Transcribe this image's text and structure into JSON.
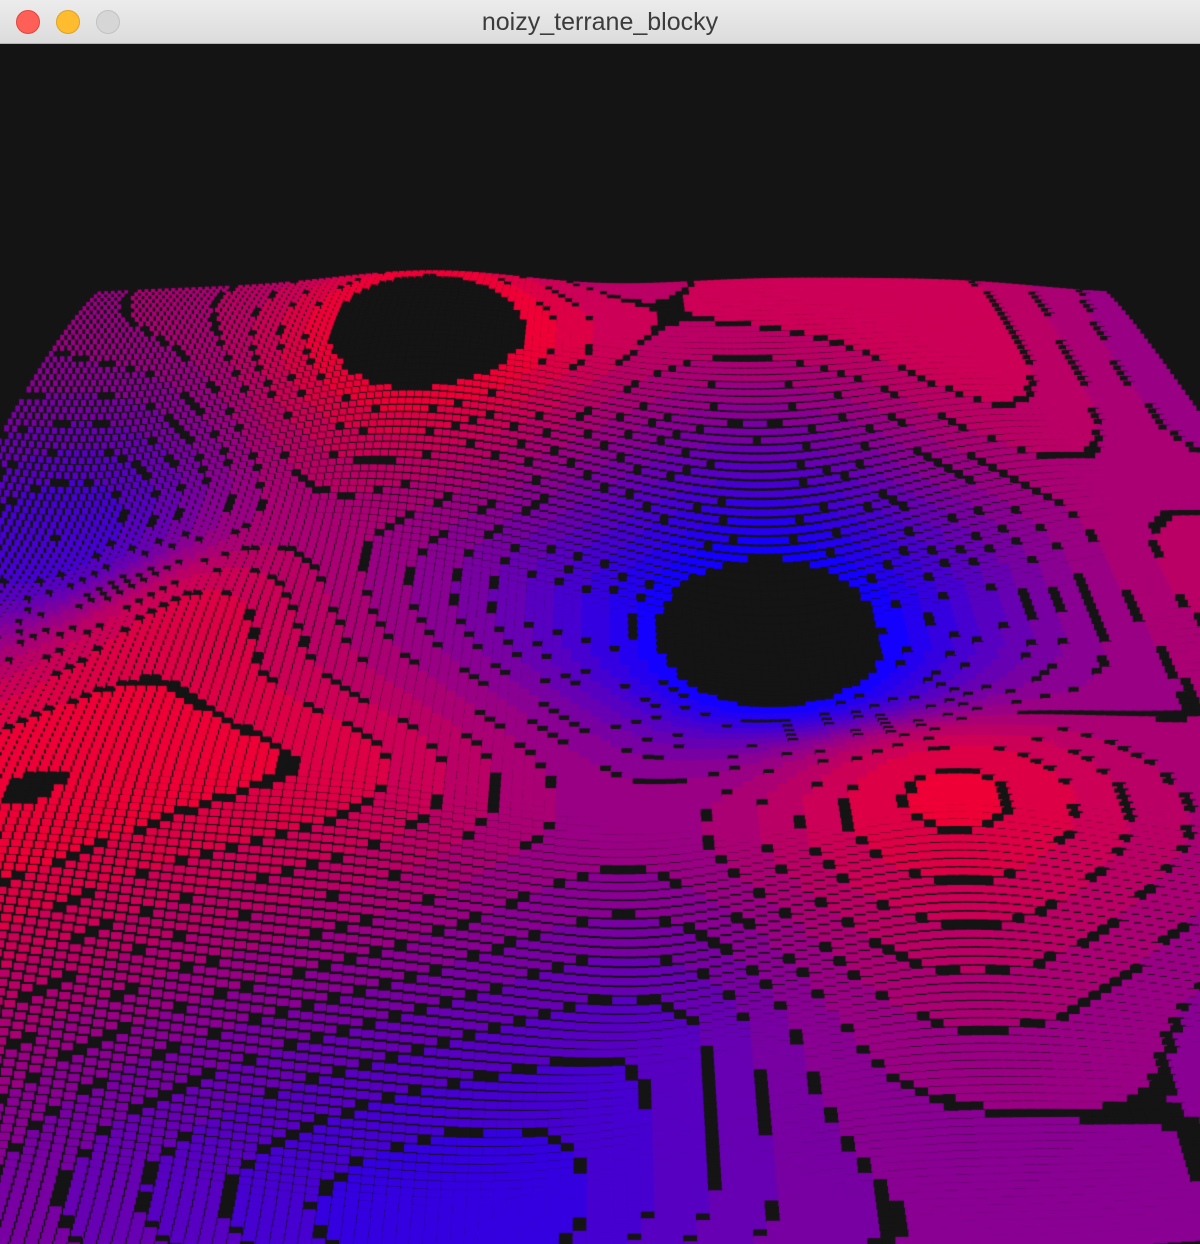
{
  "window": {
    "title": "noizy_terrane_blocky",
    "controls": {
      "close": "close-icon",
      "minimize": "minimize-icon",
      "zoom": "zoom-icon"
    },
    "colors": {
      "close": "#fe5f57",
      "minimize": "#febc2e",
      "zoom": "#d6d6d6"
    }
  },
  "scene": {
    "background": "#141414",
    "high_color": "#ff0028",
    "low_color": "#1400ff",
    "contour_color": "#141414",
    "description_icon": "terrain-heightmap"
  }
}
